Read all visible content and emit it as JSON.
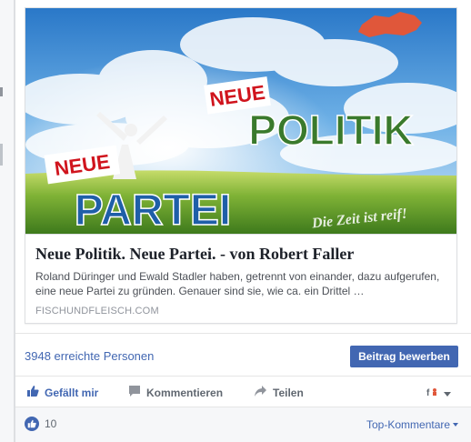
{
  "link_preview": {
    "image": {
      "headline_top_tag": "NEUE",
      "headline_top": "POLITIK",
      "headline_bottom_tag": "NEUE",
      "headline_bottom": "PARTEI",
      "slogan": "Die Zeit ist reif!"
    },
    "title": "Neue Politik. Neue Partei. - von Robert Faller",
    "description": "Roland Düringer und Ewald Stadler haben, getrennt von einander, dazu aufgerufen, eine neue Partei zu gründen. Genauer sind sie, wie ca. ein Drittel …",
    "domain": "FISCHUNDFLEISCH.COM"
  },
  "insights": {
    "reach_text": "3948 erreichte Personen",
    "boost_label": "Beitrag bewerben"
  },
  "actions": {
    "like_label": "Gefällt mir",
    "comment_label": "Kommentieren",
    "share_label": "Teilen"
  },
  "summary": {
    "like_count": "10",
    "sort_label": "Top-Kommentare"
  },
  "colors": {
    "accent": "#4267b2",
    "headline_red": "#d0141d",
    "headline_green": "#3a7a2c",
    "headline_blue": "#1f5fa8"
  },
  "icons": {
    "like": "thumbs-up-icon",
    "comment": "comment-bubble-icon",
    "share": "share-arrow-icon",
    "audience": "audience-selector-icon",
    "dropdown": "chevron-down-icon"
  }
}
